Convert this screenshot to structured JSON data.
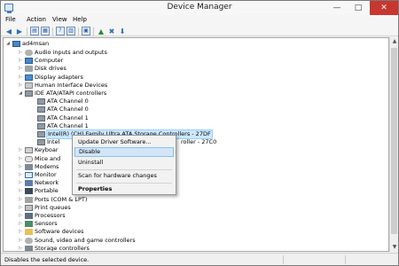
{
  "window": {
    "title": "Device Manager",
    "minimize_glyph": "—",
    "maximize_glyph": "□",
    "close_glyph": "✕"
  },
  "menu": [
    "File",
    "Action",
    "View",
    "Help"
  ],
  "toolbar": {
    "icons": [
      "back-arrow-icon",
      "forward-arrow-icon",
      "properties-icon",
      "help-icon",
      "show-hidden-icon",
      "scan-changes-icon",
      "update-driver-icon",
      "uninstall-icon",
      "disable-icon"
    ]
  },
  "tree": {
    "root": "ad4msan",
    "items": [
      {
        "label": "Audio inputs and outputs",
        "icon": "speaker-icon",
        "expand": "▷"
      },
      {
        "label": "Computer",
        "icon": "computer-icon",
        "expand": "▷"
      },
      {
        "label": "Disk drives",
        "icon": "disk-drive-icon",
        "expand": "▷"
      },
      {
        "label": "Display adapters",
        "icon": "display-adapter-icon",
        "expand": "▷"
      },
      {
        "label": "Human Interface Devices",
        "icon": "hid-icon",
        "expand": "▷"
      },
      {
        "label": "IDE ATA/ATAPI controllers",
        "icon": "ide-controller-icon",
        "expand": "◢"
      },
      {
        "label": "ATA Channel 0",
        "icon": "ide-channel-icon",
        "expand": ""
      },
      {
        "label": "ATA Channel 0",
        "icon": "ide-channel-icon",
        "expand": ""
      },
      {
        "label": "ATA Channel 1",
        "icon": "ide-channel-icon",
        "expand": ""
      },
      {
        "label": "ATA Channel 1",
        "icon": "ide-channel-icon",
        "expand": ""
      },
      {
        "label": "Intel(R) (CH) Family Ultra ATA Storage Controllers - 27DF",
        "icon": "ide-channel-icon",
        "expand": ""
      },
      {
        "label": "Intel",
        "suffix": "roller - 27C0",
        "icon": "ide-channel-icon",
        "expand": ""
      },
      {
        "label": "Keyboar",
        "icon": "keyboard-icon",
        "expand": "▷"
      },
      {
        "label": "Mice and",
        "icon": "mouse-icon",
        "expand": "▷"
      },
      {
        "label": "Modems",
        "icon": "modem-icon",
        "expand": "▷"
      },
      {
        "label": "Monitor",
        "icon": "monitor-icon",
        "expand": "▷"
      },
      {
        "label": "Network",
        "icon": "network-icon",
        "expand": "▷"
      },
      {
        "label": "Portable",
        "icon": "portable-device-icon",
        "expand": "▷"
      },
      {
        "label": "Ports (COM & LPT)",
        "icon": "port-icon",
        "expand": "▷"
      },
      {
        "label": "Print queues",
        "icon": "printer-icon",
        "expand": "▷"
      },
      {
        "label": "Processors",
        "icon": "processor-icon",
        "expand": "▷"
      },
      {
        "label": "Sensors",
        "icon": "sensor-icon",
        "expand": "▷"
      },
      {
        "label": "Software devices",
        "icon": "software-device-icon",
        "expand": "▷"
      },
      {
        "label": "Sound, video and game controllers",
        "icon": "sound-icon",
        "expand": "▷"
      },
      {
        "label": "Storage controllers",
        "icon": "storage-controller-icon",
        "expand": "▷"
      }
    ]
  },
  "context_menu": {
    "update_driver": "Update Driver Software...",
    "disable": "Disable",
    "uninstall": "Uninstall",
    "scan": "Scan for hardware changes",
    "properties": "Properties"
  },
  "status": {
    "text": "Disables the selected device."
  },
  "colors": {
    "selection": "#cce8ff",
    "menu_hover": "#d1e6f8",
    "close_button": "#c7372f"
  }
}
